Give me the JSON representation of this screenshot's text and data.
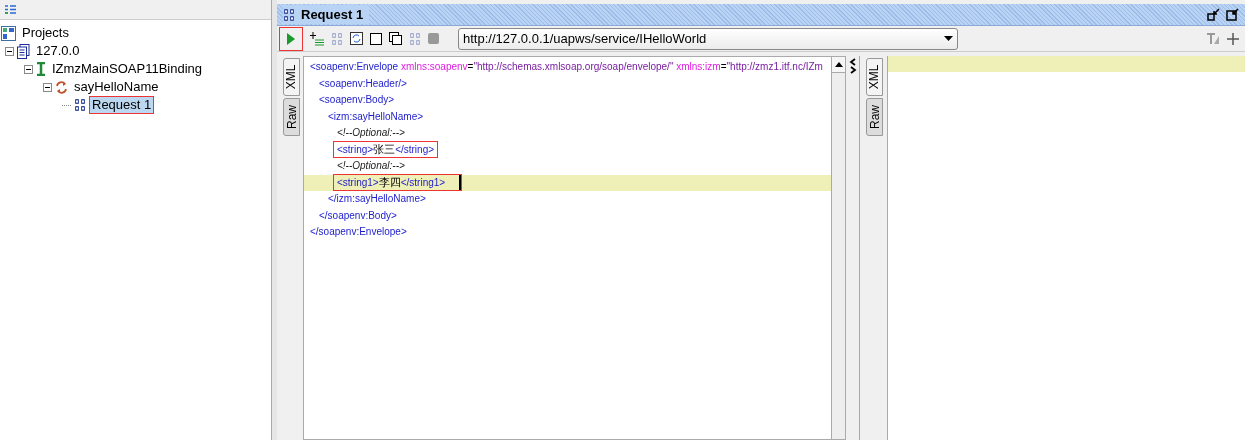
{
  "navigator": {
    "tree": [
      {
        "label": "Projects",
        "kind": "projects",
        "selected": false,
        "marked": false,
        "children": [
          {
            "label": "127.0.0",
            "kind": "project",
            "selected": false,
            "marked": false,
            "children": [
              {
                "label": "IZmzMainSOAP11Binding",
                "kind": "binding",
                "selected": false,
                "marked": false,
                "children": [
                  {
                    "label": "sayHelloName",
                    "kind": "operation",
                    "selected": false,
                    "marked": false,
                    "children": [
                      {
                        "label": "Request 1",
                        "kind": "request",
                        "selected": true,
                        "marked": true
                      }
                    ]
                  }
                ]
              }
            ]
          }
        ]
      }
    ]
  },
  "request": {
    "title": "Request 1",
    "run_marked": true,
    "endpoint": "http://127.0.0.1/uapws/service/IHelloWorld",
    "request_tabs": [
      {
        "label": "XML",
        "selected": true
      },
      {
        "label": "Raw",
        "selected": false
      }
    ],
    "response_tabs": [
      {
        "label": "XML",
        "selected": true
      },
      {
        "label": "Raw",
        "selected": false
      }
    ],
    "xml": [
      {
        "tokens": [
          {
            "kind": "tag",
            "text": "<soapenv:Envelope "
          },
          {
            "kind": "attr",
            "text": "xmlns:soapenv"
          },
          {
            "kind": "eq",
            "text": "="
          },
          {
            "kind": "value",
            "text": "\"http://schemas.xmlsoap.org/soap/envelope/\""
          },
          {
            "kind": "attr",
            "text": " xmlns:izm"
          },
          {
            "kind": "eq",
            "text": "="
          },
          {
            "kind": "value",
            "text": "\"http://zmz1.itf.nc/IZm"
          }
        ],
        "close": "</soapenv:Envelope>",
        "current": false,
        "marked": false,
        "children": [
          {
            "tokens": [
              {
                "kind": "tag",
                "text": "<soapenv:Header/>"
              }
            ],
            "current": false,
            "marked": false
          },
          {
            "tokens": [
              {
                "kind": "tag",
                "text": "<soapenv:Body>"
              }
            ],
            "close": "</soapenv:Body>",
            "current": false,
            "marked": false,
            "children": [
              {
                "tokens": [
                  {
                    "kind": "tag",
                    "text": "<izm:sayHelloName>"
                  }
                ],
                "close": "</izm:sayHelloName>",
                "current": false,
                "marked": false,
                "children": [
                  {
                    "tokens": [
                      {
                        "kind": "comment",
                        "text": "<!--Optional:-->"
                      }
                    ],
                    "current": false,
                    "marked": false
                  },
                  {
                    "tokens": [
                      {
                        "kind": "tag",
                        "text": "<string>"
                      },
                      {
                        "kind": "text",
                        "text": "张三"
                      },
                      {
                        "kind": "tag",
                        "text": "</string>"
                      }
                    ],
                    "current": false,
                    "marked": true
                  },
                  {
                    "tokens": [
                      {
                        "kind": "comment",
                        "text": "<!--Optional:-->"
                      }
                    ],
                    "current": false,
                    "marked": false
                  },
                  {
                    "tokens": [
                      {
                        "kind": "tag",
                        "text": "<string1>"
                      },
                      {
                        "kind": "text",
                        "text": "李四"
                      },
                      {
                        "kind": "tag",
                        "text": "</string1>"
                      }
                    ],
                    "current": true,
                    "marked": true
                  }
                ]
              }
            ]
          }
        ]
      }
    ]
  }
}
